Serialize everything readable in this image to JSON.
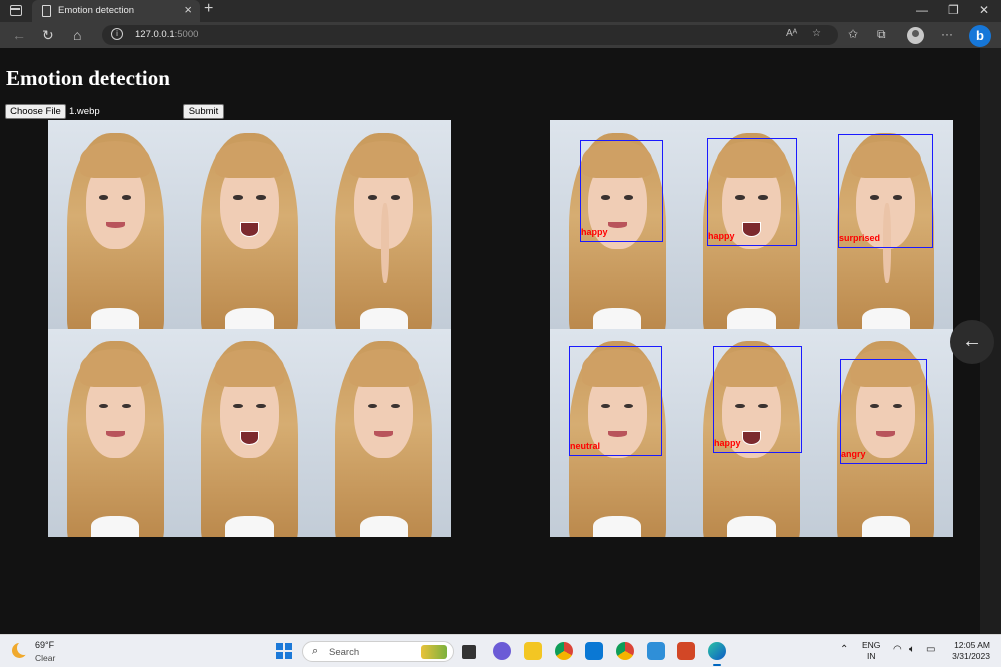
{
  "browser": {
    "tab_title": "Emotion detection",
    "url_host": "127.0.0.1",
    "url_port": ":5000",
    "new_tab_label": "+",
    "close_tab_label": "×"
  },
  "page": {
    "heading": "Emotion detection",
    "choose_file_label": "Choose File",
    "file_name": "1.webp",
    "submit_label": "Submit"
  },
  "result": {
    "detections": [
      "happy",
      "happy",
      "surprised",
      "neutral",
      "happy",
      "angry"
    ],
    "box_color": "#1a1aff",
    "label_color": "#ff0000"
  },
  "taskbar": {
    "temperature": "69°F",
    "condition": "Clear",
    "search_placeholder": "Search",
    "lang_top": "ENG",
    "lang_bottom": "IN",
    "time": "12:05 AM",
    "date": "3/31/2023"
  }
}
